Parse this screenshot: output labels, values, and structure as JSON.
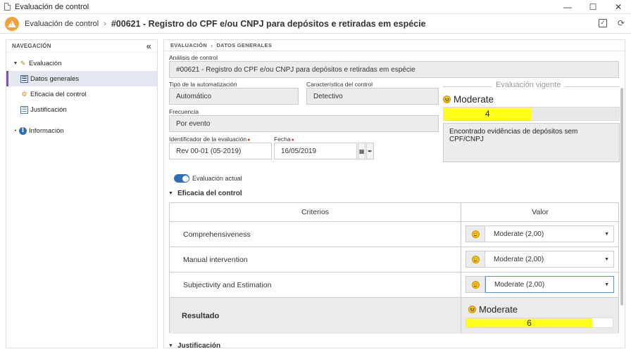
{
  "window": {
    "title": "Evaluación de control",
    "minimize_icon": "minimize-icon",
    "maximize_icon": "maximize-icon",
    "close_icon": "close-icon"
  },
  "header": {
    "module": "Evaluación de control",
    "title": "#00621 - Registro do CPF e/ou CNPJ para depósitos e retiradas em espécie",
    "colors": {
      "warning": "#f0a23a"
    }
  },
  "sidebar": {
    "heading": "NAVEGACIÓN",
    "items": [
      {
        "label": "Evaluación",
        "icon": "evaluation-icon"
      },
      {
        "label": "Datos generales",
        "icon": "document-icon",
        "active": true
      },
      {
        "label": "Eficacia del control",
        "icon": "efficacy-icon"
      },
      {
        "label": "Justificación",
        "icon": "justification-icon"
      },
      {
        "label": "Información",
        "icon": "info-icon"
      }
    ]
  },
  "breadcrumb": {
    "root": "EVALUACIÓN",
    "current": "DATOS GENERALES"
  },
  "form": {
    "analisis_label": "Análisis de control",
    "analisis_value": "#00621 - Registro do CPF e/ou CNPJ para depósitos e retiradas em espécie",
    "tipo_label": "Tipo de la automatización",
    "tipo_value": "Automático",
    "caracteristica_label": "Característica del control",
    "caracteristica_value": "Detectivo",
    "frecuencia_label": "Frecuencia",
    "frecuencia_value": "Por evento",
    "identificador_label": "Identificador de la evaluación",
    "identificador_value": "Rev 00-01 (05-2019)",
    "fecha_label": "Fecha",
    "fecha_value": "16/05/2019",
    "required_mark": "●"
  },
  "vigente": {
    "title": "Evaluación vigente",
    "level": "Moderate",
    "score": "4",
    "score_fraction": 0.5,
    "summary": "Encontrado evidências de depósitos sem CPF/CNPJ",
    "color": "#ffff1e"
  },
  "toggle": {
    "label": "Evaluación actual",
    "on": true
  },
  "eficacia": {
    "heading": "Eficacia del control",
    "col_criterios": "Criterios",
    "col_valor": "Valor",
    "rows": [
      {
        "criterio": "Comprehensiveness",
        "valor": "Moderate (2,00)"
      },
      {
        "criterio": "Manual intervention",
        "valor": "Moderate (2,00)"
      },
      {
        "criterio": "Subjectivity and Estimation",
        "valor": "Moderate (2,00)"
      }
    ],
    "resultado_label": "Resultado",
    "resultado_level": "Moderate",
    "resultado_score": "6",
    "resultado_fraction": 0.86
  },
  "justificacion": {
    "heading": "Justificación"
  }
}
